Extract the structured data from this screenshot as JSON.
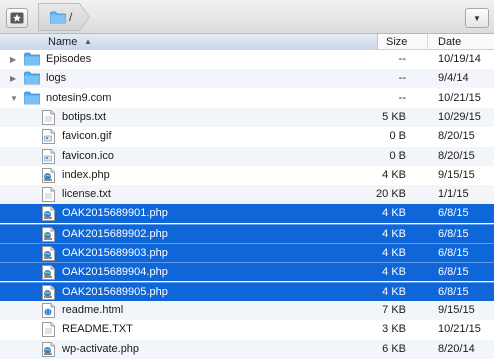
{
  "pathbar": {
    "path_label": "/"
  },
  "columns": {
    "name": "Name",
    "size": "Size",
    "date": "Date"
  },
  "colors": {
    "selection": "#0e66d8",
    "folder": "#5eb4f2"
  },
  "rows": [
    {
      "name": "Episodes",
      "kind": "folder",
      "disclosure": "collapsed",
      "size": "--",
      "date": "10/19/14",
      "selected": false
    },
    {
      "name": "logs",
      "kind": "folder",
      "disclosure": "collapsed",
      "size": "--",
      "date": "9/4/14",
      "selected": false
    },
    {
      "name": "notesin9.com",
      "kind": "folder",
      "disclosure": "expanded",
      "size": "--",
      "date": "10/21/15",
      "selected": false
    },
    {
      "name": "botips.txt",
      "kind": "txt-file",
      "size": "5 KB",
      "date": "10/29/15",
      "selected": false
    },
    {
      "name": "favicon.gif",
      "kind": "image-file",
      "size": "0 B",
      "date": "8/20/15",
      "selected": false
    },
    {
      "name": "favicon.ico",
      "kind": "image-file",
      "size": "0 B",
      "date": "8/20/15",
      "selected": false
    },
    {
      "name": "index.php",
      "kind": "php-file",
      "size": "4 KB",
      "date": "9/15/15",
      "selected": false
    },
    {
      "name": "license.txt",
      "kind": "txt-file",
      "size": "20 KB",
      "date": "1/1/15",
      "selected": false
    },
    {
      "name": "OAK2015689901.php",
      "kind": "php-file",
      "size": "4 KB",
      "date": "6/8/15",
      "selected": true
    },
    {
      "name": "OAK2015689902.php",
      "kind": "php-file",
      "size": "4 KB",
      "date": "6/8/15",
      "selected": true
    },
    {
      "name": "OAK2015689903.php",
      "kind": "php-file",
      "size": "4 KB",
      "date": "6/8/15",
      "selected": true
    },
    {
      "name": "OAK2015689904.php",
      "kind": "php-file",
      "size": "4 KB",
      "date": "6/8/15",
      "selected": true
    },
    {
      "name": "OAK2015689905.php",
      "kind": "php-file",
      "size": "4 KB",
      "date": "6/8/15",
      "selected": true
    },
    {
      "name": "readme.html",
      "kind": "html-file",
      "size": "7 KB",
      "date": "9/15/15",
      "selected": false
    },
    {
      "name": "README.TXT",
      "kind": "txt-file",
      "size": "3 KB",
      "date": "10/21/15",
      "selected": false
    },
    {
      "name": "wp-activate.php",
      "kind": "php-file",
      "size": "6 KB",
      "date": "8/20/14",
      "selected": false
    }
  ]
}
